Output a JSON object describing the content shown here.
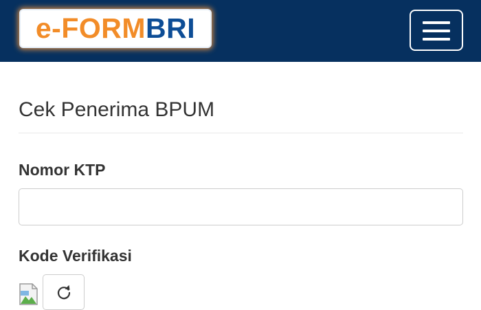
{
  "header": {
    "logo": {
      "part_a": "e-FORM",
      "part_b": "BRI"
    },
    "menu_icon": "hamburger-menu-icon"
  },
  "main": {
    "title": "Cek Penerima BPUM",
    "ktp_field": {
      "label": "Nomor KTP",
      "value": "",
      "placeholder": ""
    },
    "verification": {
      "label": "Kode Verifikasi",
      "captcha_icon": "broken-image-icon",
      "refresh_icon": "refresh-icon"
    }
  },
  "colors": {
    "navbar": "#06305f",
    "logo_orange": "#f28c28",
    "logo_blue": "#0d4d96",
    "text": "#333333"
  }
}
